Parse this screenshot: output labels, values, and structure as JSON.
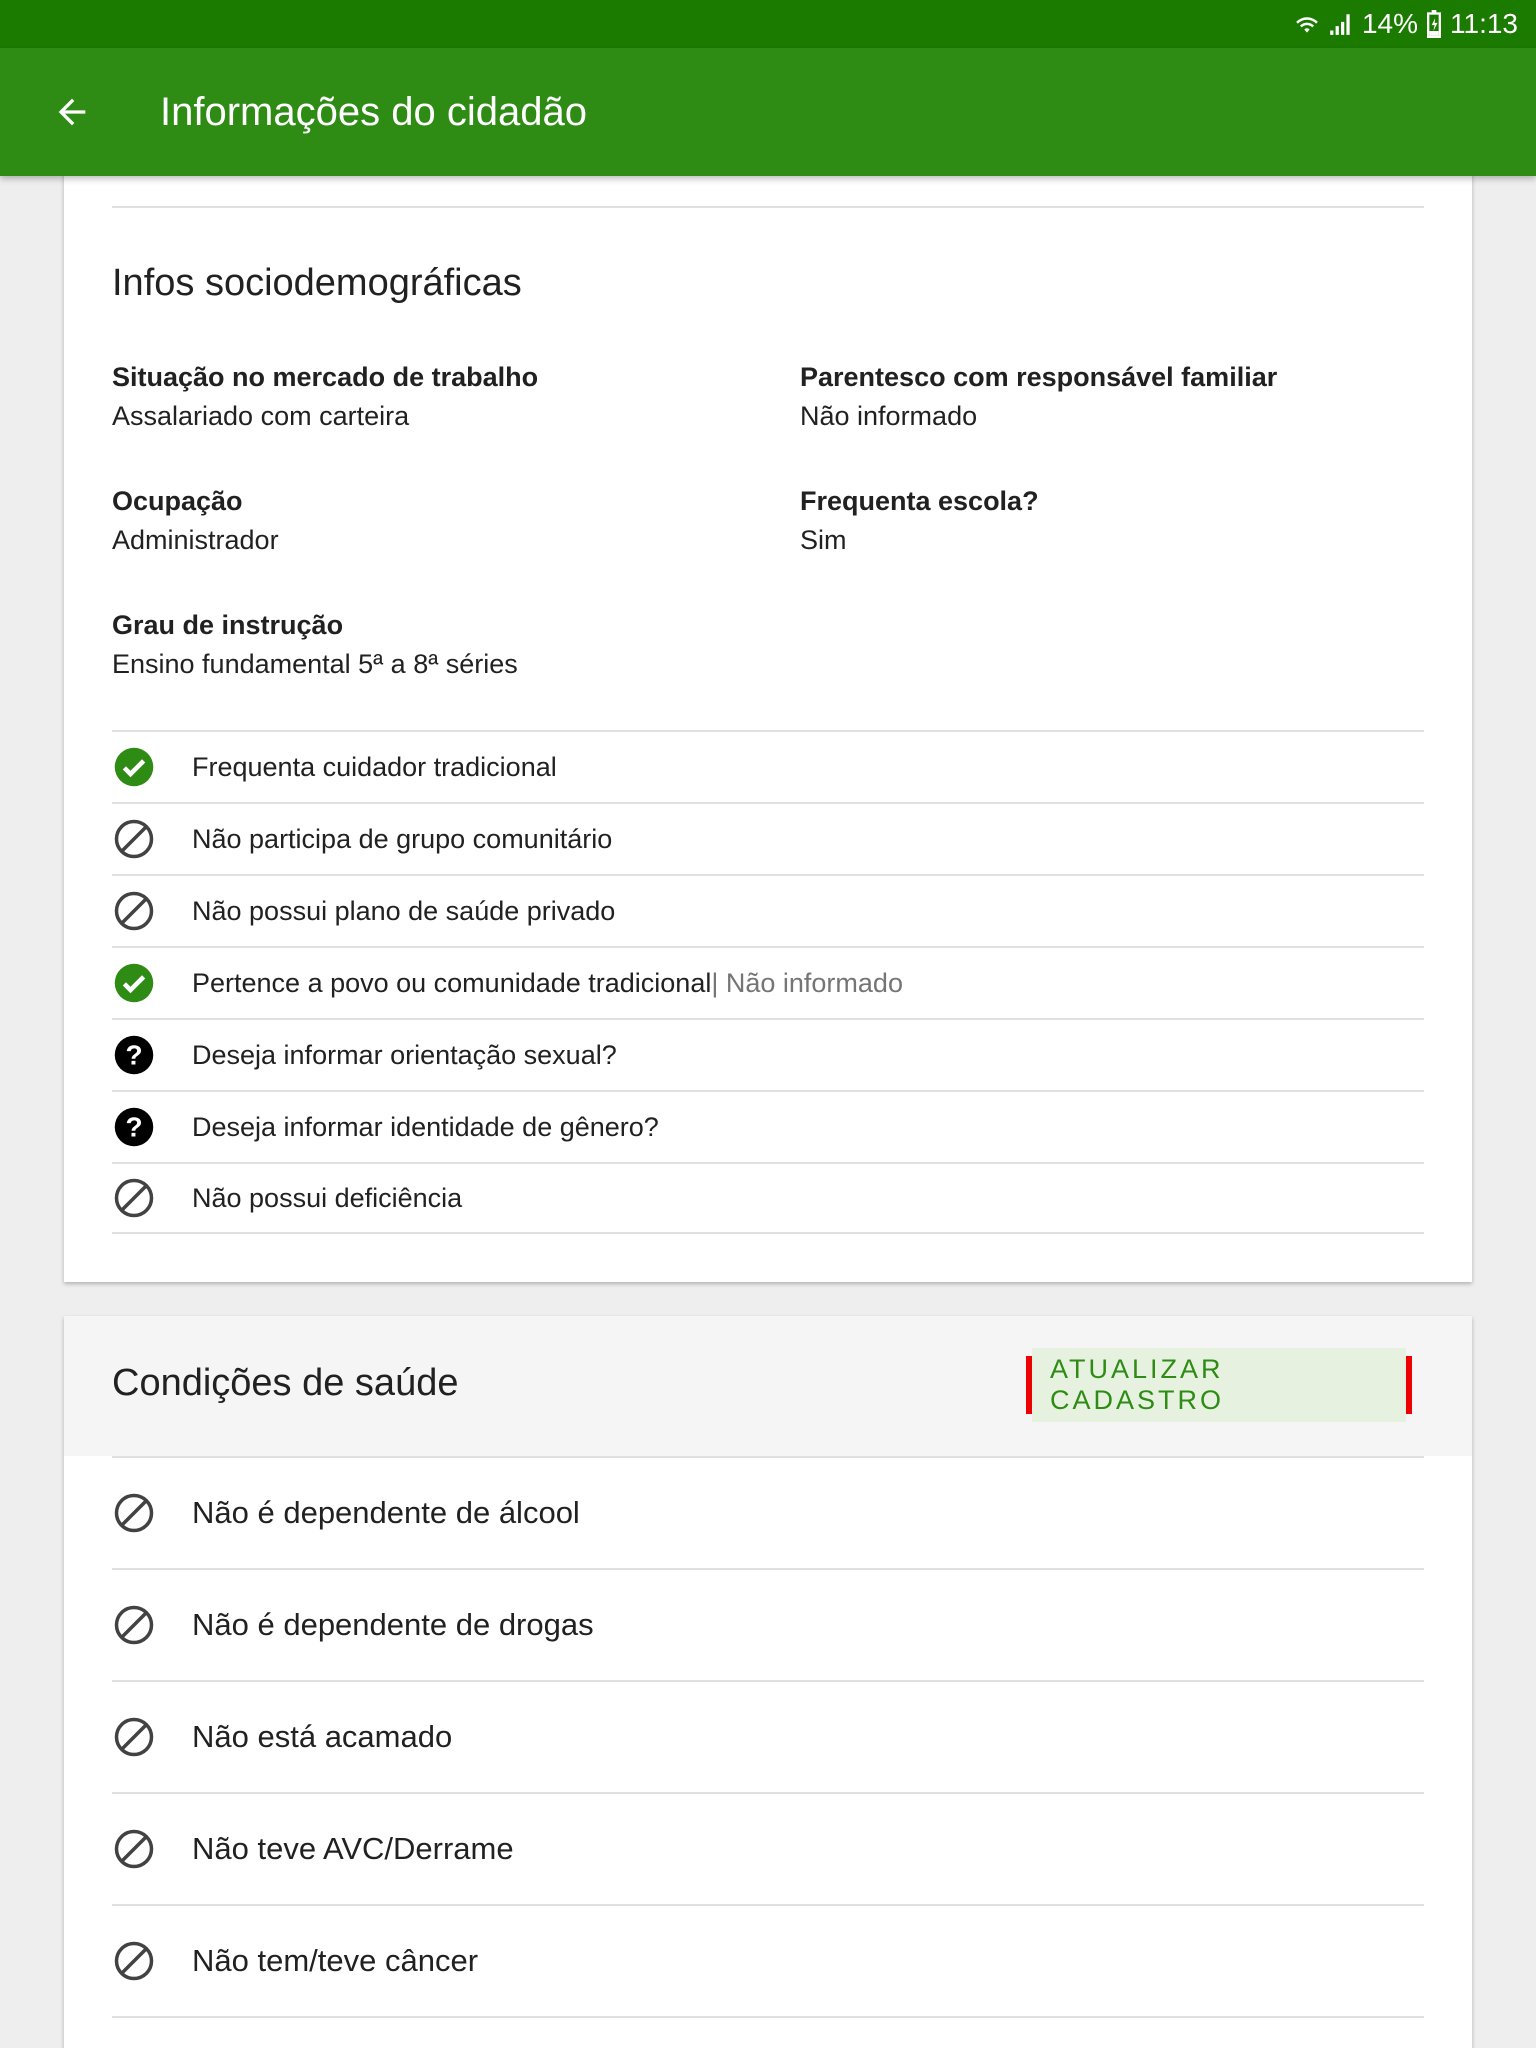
{
  "status_bar": {
    "battery": "14%",
    "time": "11:13"
  },
  "app_bar": {
    "title": "Informações do cidadão",
    "back_icon": "arrow-back-icon"
  },
  "socio": {
    "title": "Infos sociodemográficas",
    "fields": [
      {
        "label": "Situação no mercado de trabalho",
        "value": "Assalariado com carteira"
      },
      {
        "label": "Parentesco com responsável familiar",
        "value": "Não informado"
      },
      {
        "label": "Ocupação",
        "value": "Administrador"
      },
      {
        "label": "Frequenta escola?",
        "value": "Sim"
      },
      {
        "label": "Grau de instrução",
        "value": "Ensino fundamental 5ª a 8ª séries"
      }
    ],
    "items": [
      {
        "icon": "check-circle-icon",
        "text": "Frequenta cuidador tradicional",
        "extra": ""
      },
      {
        "icon": "block-icon",
        "text": "Não participa de grupo comunitário",
        "extra": ""
      },
      {
        "icon": "block-icon",
        "text": "Não possui plano de saúde privado",
        "extra": ""
      },
      {
        "icon": "check-circle-icon",
        "text": "Pertence a povo ou comunidade tradicional",
        "extra": " | Não informado"
      },
      {
        "icon": "help-circle-icon",
        "text": "Deseja informar orientação sexual?",
        "extra": ""
      },
      {
        "icon": "help-circle-icon",
        "text": "Deseja informar identidade de gênero?",
        "extra": ""
      },
      {
        "icon": "block-icon",
        "text": "Não possui deficiência",
        "extra": ""
      }
    ]
  },
  "health": {
    "title": "Condições de saúde",
    "update_button": "ATUALIZAR CADASTRO",
    "items": [
      {
        "icon": "block-icon",
        "text": "Não é dependente de álcool"
      },
      {
        "icon": "block-icon",
        "text": "Não é dependente de drogas"
      },
      {
        "icon": "block-icon",
        "text": "Não está acamado"
      },
      {
        "icon": "block-icon",
        "text": "Não teve AVC/Derrame"
      },
      {
        "icon": "block-icon",
        "text": "Não tem/teve câncer"
      }
    ]
  },
  "colors": {
    "status_bar": "#1b7a00",
    "app_bar": "#2e8b14",
    "check": "#2e8b14",
    "highlight": "#ee0000"
  }
}
